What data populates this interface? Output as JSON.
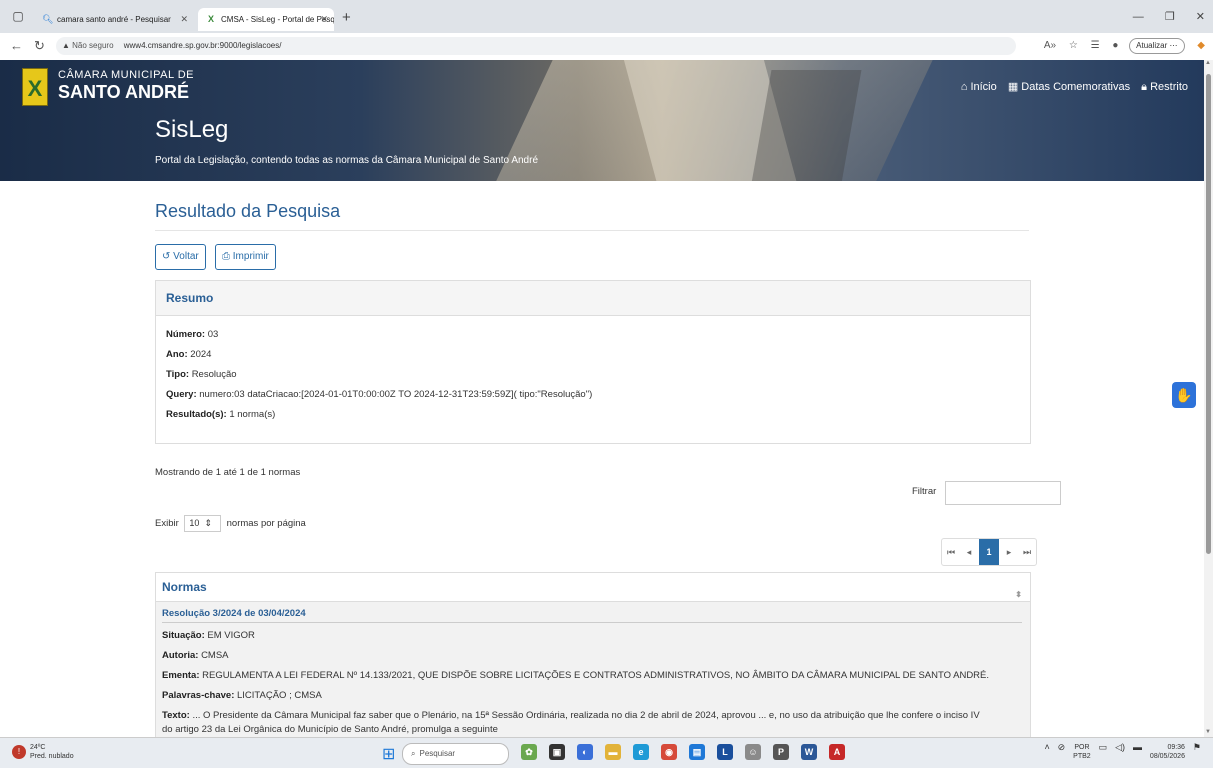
{
  "browser": {
    "tabs": [
      {
        "title": "camara santo andré - Pesquisar",
        "active": false
      },
      {
        "title": "CMSA - SisLeg - Portal de Pesqui",
        "active": true
      }
    ],
    "url_security": "Não seguro",
    "url": "www4.cmsandre.sp.gov.br:9000/legislacoes/",
    "update_label": "Atualizar"
  },
  "header": {
    "institution_line1": "CÂMARA MUNICIPAL DE",
    "institution_line2": "SANTO ANDRÉ",
    "system_name": "SisLeg",
    "tagline": "Portal da Legislação, contendo todas as normas da Câmara Municipal de Santo André",
    "nav": [
      "Início",
      "Datas Comemorativas",
      "Restrito"
    ]
  },
  "main": {
    "title": "Resultado da Pesquisa",
    "buttons": {
      "back": "Voltar",
      "print": "Imprimir"
    },
    "summary": {
      "heading": "Resumo",
      "numero_label": "Número:",
      "numero": "03",
      "ano_label": "Ano:",
      "ano": "2024",
      "tipo_label": "Tipo:",
      "tipo": "Resolução",
      "query_label": "Query:",
      "query": "numero:03 dataCriacao:[2024-01-01T0:00:00Z TO 2024-12-31T23:59:59Z]( tipo:\"Resolução\")",
      "resultados_label": "Resultado(s):",
      "resultados": "1 norma(s)"
    },
    "showing": "Mostrando de 1 até 1 de 1 normas",
    "filter_label": "Filtrar",
    "per_page_prefix": "Exibir",
    "per_page_value": "10",
    "per_page_suffix": "normas por página",
    "pagination": {
      "first": "⏮",
      "prev": "◂",
      "current": "1",
      "next": "▸",
      "last": "⏭"
    },
    "normas": {
      "heading": "Normas",
      "item": {
        "title": "Resolução 3/2024 de 03/04/2024",
        "situacao_label": "Situação:",
        "situacao": "EM VIGOR",
        "autoria_label": "Autoria:",
        "autoria": "CMSA",
        "ementa_label": "Ementa:",
        "ementa": "REGULAMENTA A LEI FEDERAL Nº 14.133/2021, QUE DISPÕE SOBRE LICITAÇÕES E CONTRATOS ADMINISTRATIVOS, NO ÂMBITO DA CÂMARA MUNICIPAL DE SANTO ANDRÉ.",
        "palavras_label": "Palavras-chave:",
        "palavras": "LICITAÇÃO ; CMSA",
        "texto_label": "Texto:",
        "texto_line1": "... O Presidente da Câmara Municipal faz saber que o Plenário, na 15ª Sessão Ordinária, realizada no dia 2 de abril de 2024, aprovou ... e, no uso da atribuição que lhe confere o inciso IV",
        "texto_line2": "do artigo 23 da Lei Orgânica do Município de Santo André, promulga a seguinte"
      }
    }
  },
  "taskbar": {
    "weather_temp": "24ºC",
    "weather_desc": "Pred. nublado",
    "search_placeholder": "Pesquisar",
    "lang1": "POR",
    "lang2": "PTB2",
    "time": "09:36",
    "date": "08/05/2026"
  }
}
